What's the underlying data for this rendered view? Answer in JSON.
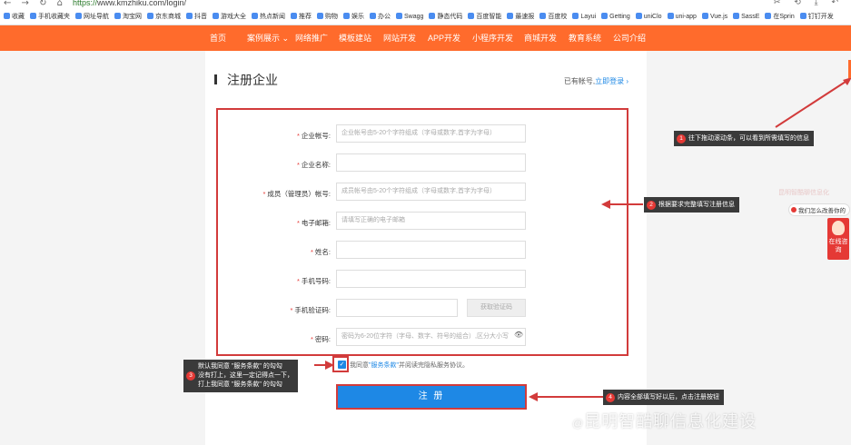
{
  "browser": {
    "nav_glyphs": "← → ↻ ⌂",
    "url_scheme": "https://",
    "url_rest": "www.kmzhiku.com/login/",
    "tool_glyphs": "✂ ⟲ ⤓ ↶",
    "bookmarks": [
      "收藏",
      "手机收藏夹",
      "网址导航",
      "淘宝网",
      "京东商城",
      "抖音",
      "游戏大全",
      "热点新闻",
      "推荐",
      "购物",
      "娱乐",
      "办公",
      "Swagg",
      "静态代码",
      "百度智能",
      "最速报",
      "百度校",
      "Layui",
      "Getting",
      "uniClo",
      "uni-app",
      "Vue.js",
      "SassE",
      "在Sprin",
      "钉钉开发"
    ]
  },
  "site_nav": {
    "items": [
      "首页",
      "案例展示 ⌄",
      "网络推广",
      "模板建站",
      "网站开发",
      "APP开发",
      "小程序开发",
      "商城开发",
      "教育系统",
      "公司介绍"
    ]
  },
  "page": {
    "title": "注册企业",
    "login_hint_prefix": "已有帐号,",
    "login_link": "立即登录 ›"
  },
  "form": {
    "fields": [
      {
        "label": "企业帐号:",
        "required": true,
        "placeholder": "企业帐号由5-20个字符组成（字母或数字,首字为字母）"
      },
      {
        "label": "企业名称:",
        "required": true,
        "placeholder": ""
      },
      {
        "label": "成员（管理员）帐号:",
        "required": true,
        "placeholder": "成员帐号由5-20个字符组成（字母或数字,首字为字母）"
      },
      {
        "label": "电子邮箱:",
        "required": true,
        "placeholder": "请填写正确的电子邮箱"
      },
      {
        "label": "姓名:",
        "required": true,
        "placeholder": ""
      },
      {
        "label": "手机号码:",
        "required": true,
        "placeholder": ""
      },
      {
        "label": "手机验证码:",
        "required": true,
        "placeholder": ""
      },
      {
        "label": "密码:",
        "required": true,
        "placeholder": "密码为6-20位字符（字母、数字、符号的组合）,区分大小写"
      }
    ],
    "code_button": "获取验证码",
    "password_eye": "👁",
    "agree_check": "✓",
    "agree_prefix": "我同意",
    "agree_link": "\"服务条款\"",
    "agree_suffix": "并阅读完隐私服务协议。",
    "submit": "注 册"
  },
  "annotations": [
    {
      "num": "1",
      "text": "往下拖动滚动条，可以看到所需填写的信息"
    },
    {
      "num": "2",
      "text": "根据要求完整填写注册信息"
    },
    {
      "num": "3",
      "lines": [
        "默认我同意 \"服务条款\" 的勾勾",
        "没有打上，这里一定记得点一下，",
        "打上我同意 \"服务条款\" 的勾勾"
      ]
    },
    {
      "num": "4",
      "text": "内容全部填写好以后，点击注册按钮"
    }
  ],
  "widgets": {
    "ghost_text": "昆明智酷聊信息化",
    "ask_text": "我们怎么改善你的",
    "service_text": "在线咨询"
  },
  "watermark": {
    "at": "@",
    "text": "昆明智酷聊信息化建设"
  },
  "colors": {
    "brand_orange": "#ff6b2c",
    "primary_blue": "#1e88e5",
    "annotation_red": "#d23b3b"
  }
}
